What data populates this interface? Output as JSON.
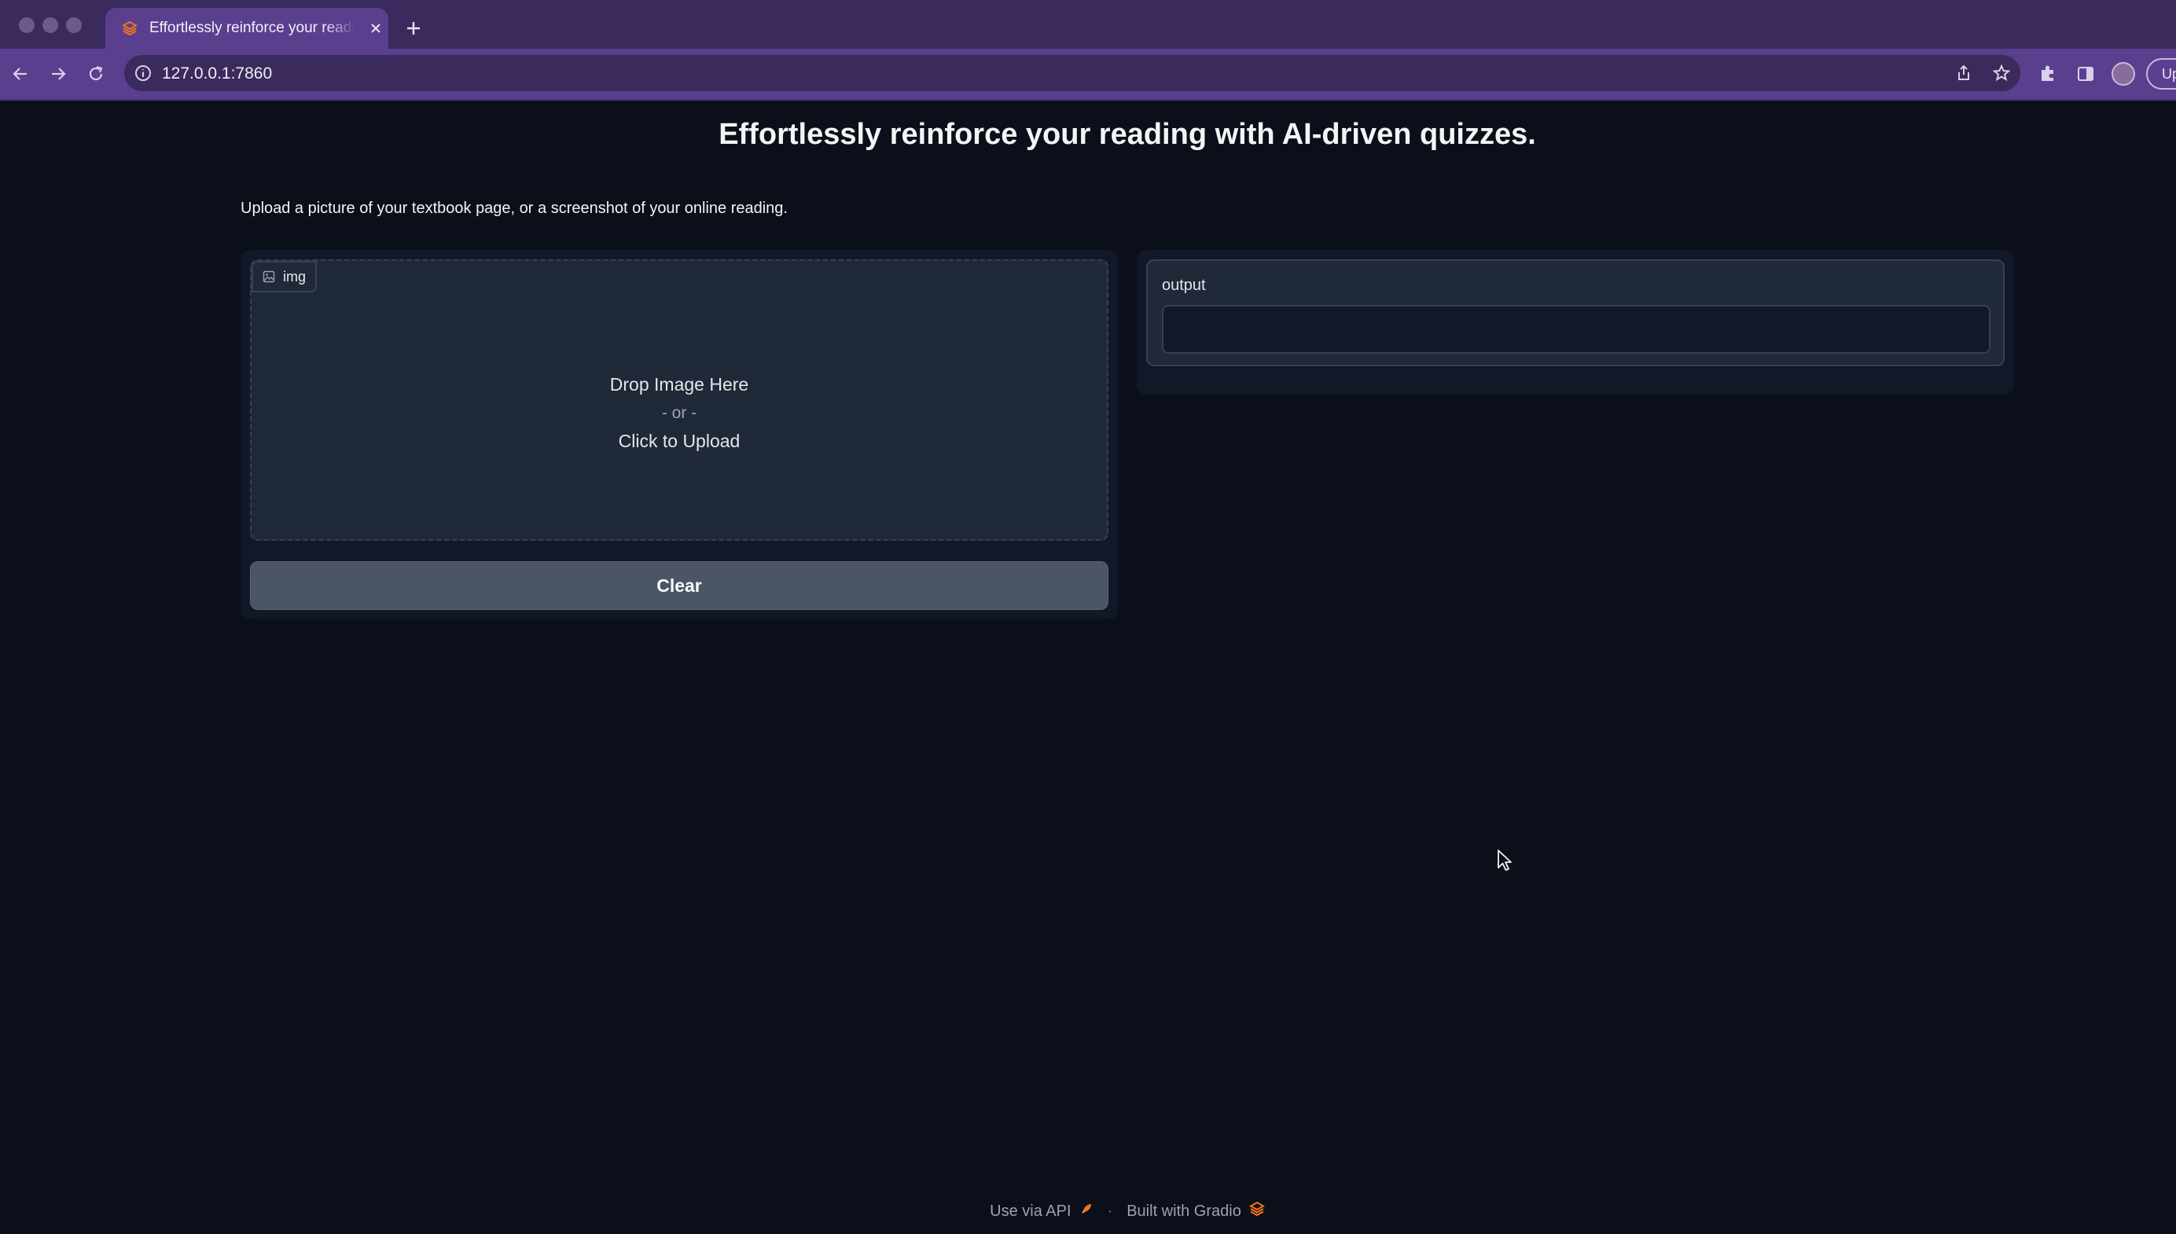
{
  "browser": {
    "tab_title": "Effortlessly reinforce your reading with AI-driven quizzes.",
    "url": "127.0.0.1:7860",
    "update_label": "Up"
  },
  "page": {
    "title": "Effortlessly reinforce your reading with AI-driven quizzes.",
    "description": "Upload a picture of your textbook page, or a screenshot of your online reading."
  },
  "input": {
    "label": "img",
    "drop_text": "Drop Image Here",
    "or_text": "- or -",
    "click_text": "Click to Upload",
    "clear_label": "Clear"
  },
  "output": {
    "label": "output",
    "value": ""
  },
  "footer": {
    "api_label": "Use via API",
    "separator": "·",
    "built_label": "Built with Gradio"
  },
  "colors": {
    "background": "#0b0f19",
    "panel": "#111827",
    "block": "#1f2937",
    "button": "#4b5563",
    "browser_accent": "#5a3f8e",
    "gradio_orange": "#f97316"
  }
}
